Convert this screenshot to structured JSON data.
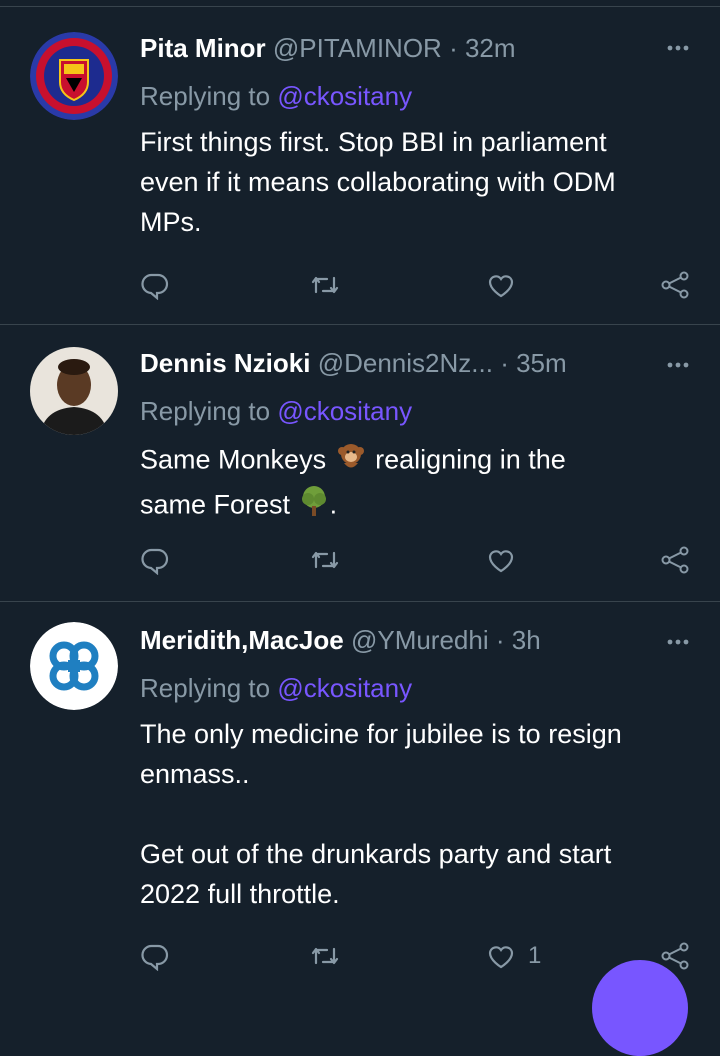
{
  "tweets": [
    {
      "name": "Pita Minor",
      "handle": "@PITAMINOR",
      "time": "· 32m",
      "replying_prefix": "Replying to",
      "replying_to": "@ckositany",
      "lines": [
        "First things first. Stop BBI in parliament",
        "even if it means collaborating with ODM",
        "MPs."
      ],
      "avatar": "manchester-united-crest",
      "like_count": ""
    },
    {
      "name": "Dennis Nzioki",
      "handle": "@Dennis2Nz...",
      "time": "· 35m",
      "replying_prefix": "Replying to",
      "replying_to": "@ckositany",
      "line1_a": "Same Monkeys",
      "line1_b": "realigning in the",
      "line2_a": "same Forest",
      "line2_b": ".",
      "emoji_1": "monkey-emoji",
      "emoji_2": "tree-emoji",
      "avatar": "person-photo",
      "like_count": ""
    },
    {
      "name": "Meridith,MacJoe",
      "handle": "@YMuredhi",
      "time": "· 3h",
      "replying_prefix": "Replying to",
      "replying_to": "@ckositany",
      "lines": [
        "The only medicine for jubilee is to resign",
        "enmass..",
        "",
        "Get out of the drunkards party and start",
        "2022 full throttle."
      ],
      "avatar": "blue-knot-logo",
      "like_count": "1"
    }
  ],
  "icons": {
    "reply": "reply-icon",
    "retweet": "retweet-icon",
    "like": "heart-icon",
    "share": "share-icon",
    "more": "more-icon"
  },
  "colors": {
    "background": "#15202b",
    "secondary_text": "#8899a6",
    "accent": "#7856ff",
    "divider": "#38444d"
  }
}
